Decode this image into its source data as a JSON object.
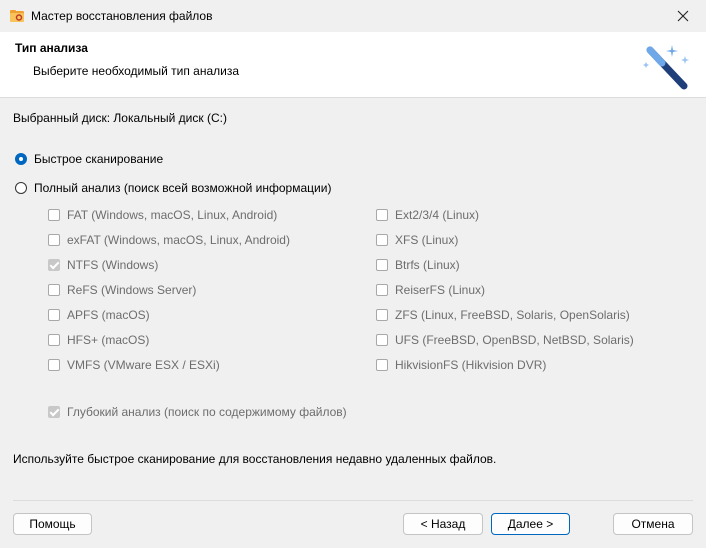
{
  "window": {
    "title": "Мастер восстановления файлов"
  },
  "header": {
    "title": "Тип анализа",
    "subtitle": "Выберите необходимый тип анализа"
  },
  "disk_label": "Выбранный диск: Локальный диск (C:)",
  "scan_options": {
    "quick": {
      "label": "Быстрое сканирование",
      "selected": true
    },
    "full": {
      "label": "Полный анализ (поиск всей возможной информации)",
      "selected": false
    }
  },
  "filesystems_left": [
    {
      "label": "FAT (Windows, macOS, Linux, Android)",
      "checked": false
    },
    {
      "label": "exFAT (Windows, macOS, Linux, Android)",
      "checked": false
    },
    {
      "label": "NTFS (Windows)",
      "checked": true
    },
    {
      "label": "ReFS (Windows Server)",
      "checked": false
    },
    {
      "label": "APFS (macOS)",
      "checked": false
    },
    {
      "label": "HFS+ (macOS)",
      "checked": false
    },
    {
      "label": "VMFS (VMware ESX / ESXi)",
      "checked": false
    }
  ],
  "filesystems_right": [
    {
      "label": "Ext2/3/4 (Linux)",
      "checked": false
    },
    {
      "label": "XFS (Linux)",
      "checked": false
    },
    {
      "label": "Btrfs (Linux)",
      "checked": false
    },
    {
      "label": "ReiserFS (Linux)",
      "checked": false
    },
    {
      "label": "ZFS (Linux, FreeBSD, Solaris, OpenSolaris)",
      "checked": false
    },
    {
      "label": "UFS (FreeBSD, OpenBSD, NetBSD, Solaris)",
      "checked": false
    },
    {
      "label": "HikvisionFS (Hikvision DVR)",
      "checked": false
    }
  ],
  "deep_analysis": {
    "label": "Глубокий анализ (поиск по содержимому файлов)",
    "checked": true
  },
  "hint": "Используйте быстрое сканирование для восстановления недавно удаленных файлов.",
  "buttons": {
    "help": "Помощь",
    "back": "< Назад",
    "next": "Далее >",
    "cancel": "Отмена"
  },
  "colors": {
    "accent": "#0067c0",
    "disabled_text": "#6d6d6d"
  }
}
